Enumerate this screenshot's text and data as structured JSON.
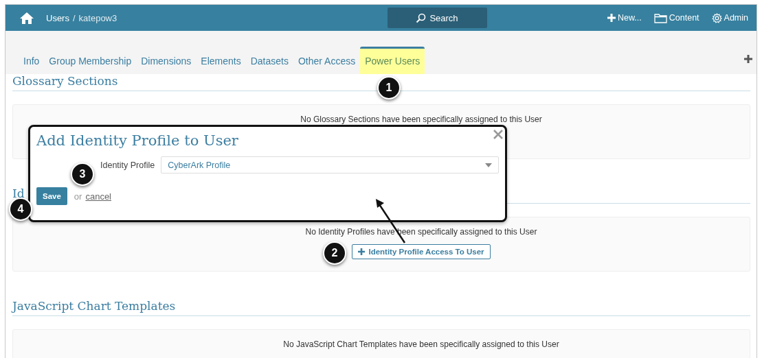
{
  "header": {
    "breadcrumb_parent": "Users",
    "separator": "/",
    "breadcrumb_current": "katepow3",
    "search_label": "Search",
    "actions": [
      {
        "kind": "new",
        "label": "New..."
      },
      {
        "kind": "content",
        "label": "Content"
      },
      {
        "kind": "admin",
        "label": "Admin"
      }
    ]
  },
  "tabs": [
    {
      "label": "Info",
      "selected": false
    },
    {
      "label": "Group Membership",
      "selected": false
    },
    {
      "label": "Dimensions",
      "selected": false
    },
    {
      "label": "Elements",
      "selected": false
    },
    {
      "label": "Datasets",
      "selected": false
    },
    {
      "label": "Other Access",
      "selected": false
    },
    {
      "label": "Power Users",
      "selected": true
    }
  ],
  "sections": [
    {
      "title": "Glossary Sections",
      "message": "No Glossary Sections have been specifically assigned to this User"
    },
    {
      "title": "Id",
      "message": "No Identity Profiles have been specifically assigned to this User",
      "button": "Identity Profile Access To User"
    },
    {
      "title": "JavaScript Chart Templates",
      "message": "No JavaScript Chart Templates have been specifically assigned to this User"
    }
  ],
  "dialog": {
    "title": "Add Identity Profile to User",
    "field_label": "Identity Profile",
    "field_value": "CyberArk Profile",
    "save_label": "Save",
    "or_text": "or",
    "cancel_label": "cancel"
  },
  "callouts": [
    "1",
    "2",
    "3",
    "4"
  ]
}
